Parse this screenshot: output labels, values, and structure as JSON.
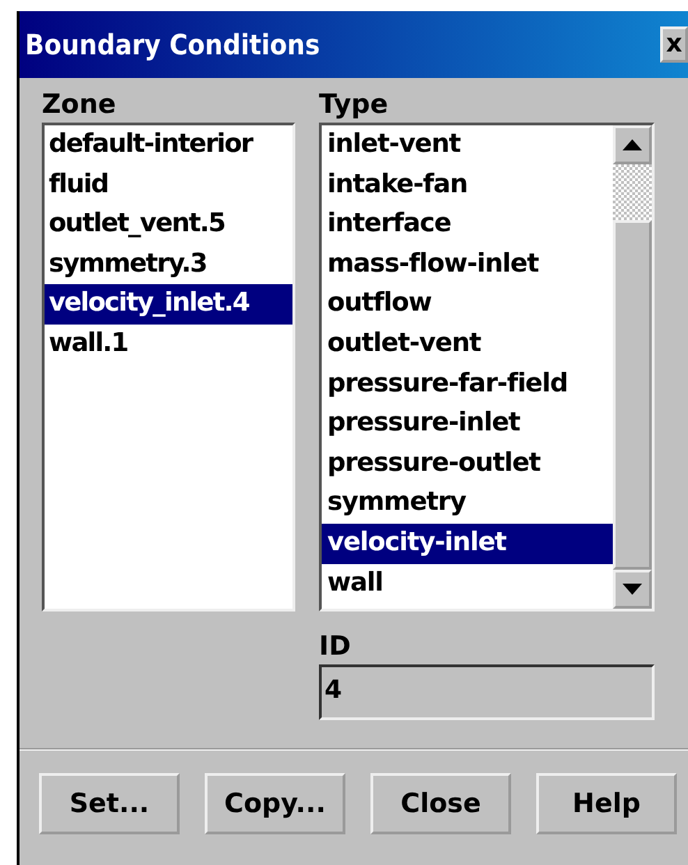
{
  "window": {
    "title": "Boundary Conditions",
    "close_glyph": "x"
  },
  "zone": {
    "label": "Zone",
    "items": [
      {
        "label": "default-interior",
        "selected": false
      },
      {
        "label": "fluid",
        "selected": false
      },
      {
        "label": "outlet_vent.5",
        "selected": false
      },
      {
        "label": "symmetry.3",
        "selected": false
      },
      {
        "label": "velocity_inlet.4",
        "selected": true
      },
      {
        "label": "wall.1",
        "selected": false
      }
    ]
  },
  "type": {
    "label": "Type",
    "items": [
      {
        "label": "inlet-vent",
        "selected": false
      },
      {
        "label": "intake-fan",
        "selected": false
      },
      {
        "label": "interface",
        "selected": false
      },
      {
        "label": "mass-flow-inlet",
        "selected": false
      },
      {
        "label": "outflow",
        "selected": false
      },
      {
        "label": "outlet-vent",
        "selected": false
      },
      {
        "label": "pressure-far-field",
        "selected": false
      },
      {
        "label": "pressure-inlet",
        "selected": false
      },
      {
        "label": "pressure-outlet",
        "selected": false
      },
      {
        "label": "symmetry",
        "selected": false
      },
      {
        "label": "velocity-inlet",
        "selected": true
      },
      {
        "label": "wall",
        "selected": false
      }
    ]
  },
  "id": {
    "label": "ID",
    "value": "4"
  },
  "buttons": [
    "Set...",
    "Copy...",
    "Close",
    "Help"
  ]
}
